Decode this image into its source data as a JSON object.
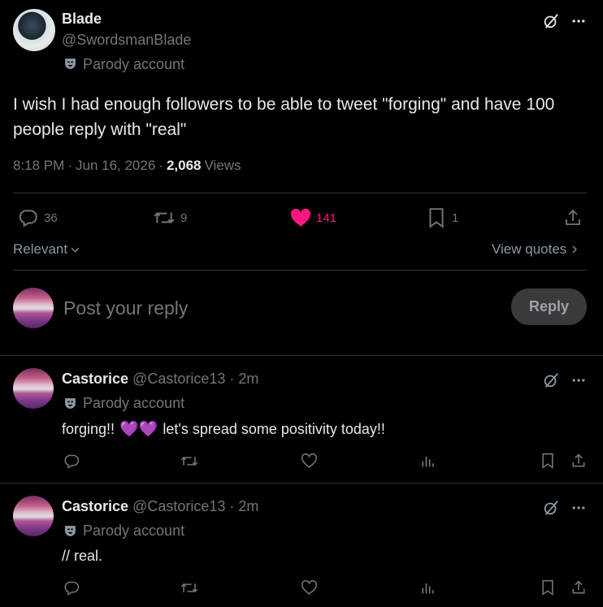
{
  "tweet": {
    "author_name": "Blade",
    "author_handle": "@SwordsmanBlade",
    "parody_label": "Parody account",
    "text": "I wish I had enough followers to be able to tweet \"forging\" and have 100 people reply with \"real\"",
    "time": "8:18 PM",
    "sep1": "·",
    "date": "Jun 16, 2026",
    "sep2": "·",
    "views_count": "2,068",
    "views_label": "Views",
    "stats": {
      "replies": "36",
      "reposts": "9",
      "likes": "141",
      "bookmarks": "1"
    },
    "like_color": "#f91880"
  },
  "sort": {
    "label": "Relevant",
    "view_quotes": "View quotes"
  },
  "composer": {
    "placeholder": "Post your reply",
    "button_label": "Reply"
  },
  "replies": [
    {
      "author_name": "Castorice",
      "author_handle": "@Castorice13",
      "sep": "·",
      "time": "2m",
      "parody_label": "Parody account",
      "text_before": "forging!!",
      "emoji": "💜💜",
      "text_after": "let's spread some positivity today!!"
    },
    {
      "author_name": "Castorice",
      "author_handle": "@Castorice13",
      "sep": "·",
      "time": "2m",
      "parody_label": "Parody account",
      "text": "// real."
    }
  ],
  "icons": {
    "grok": "grok-icon",
    "more": "more-icon",
    "parody": "parody-mask-icon",
    "reply": "reply-icon",
    "repost": "repost-icon",
    "like": "heart-icon",
    "views": "views-icon",
    "bookmark": "bookmark-icon",
    "share": "share-icon",
    "chevron": "chevron-icon"
  }
}
